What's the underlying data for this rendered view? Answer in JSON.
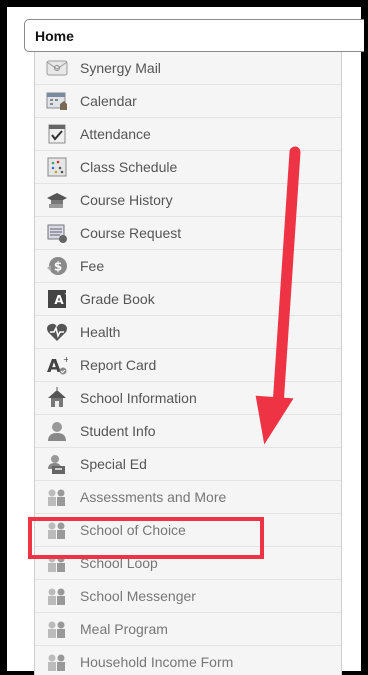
{
  "home_tab": {
    "label": "Home"
  },
  "menu": {
    "items": [
      {
        "label": "Synergy Mail",
        "icon": "mail-icon"
      },
      {
        "label": "Calendar",
        "icon": "calendar-icon"
      },
      {
        "label": "Attendance",
        "icon": "attendance-icon"
      },
      {
        "label": "Class Schedule",
        "icon": "class-schedule-icon"
      },
      {
        "label": "Course History",
        "icon": "course-history-icon"
      },
      {
        "label": "Course Request",
        "icon": "course-request-icon"
      },
      {
        "label": "Fee",
        "icon": "fee-icon"
      },
      {
        "label": "Grade Book",
        "icon": "grade-book-icon"
      },
      {
        "label": "Health",
        "icon": "health-icon"
      },
      {
        "label": "Report Card",
        "icon": "report-card-icon"
      },
      {
        "label": "School Information",
        "icon": "school-icon"
      },
      {
        "label": "Student Info",
        "icon": "student-icon"
      },
      {
        "label": "Special Ed",
        "icon": "special-ed-icon"
      },
      {
        "label": "Assessments and More",
        "icon": "people-icon"
      },
      {
        "label": "School of Choice",
        "icon": "people-icon"
      },
      {
        "label": "School Loop",
        "icon": "people-icon"
      },
      {
        "label": "School Messenger",
        "icon": "people-icon"
      },
      {
        "label": "Meal Program",
        "icon": "people-icon"
      },
      {
        "label": "Household Income Form",
        "icon": "people-icon"
      }
    ]
  },
  "annotation": {
    "highlight_color": "#ee3344",
    "arrow_color": "#ee3344",
    "highlighted_item": "School of Choice"
  }
}
